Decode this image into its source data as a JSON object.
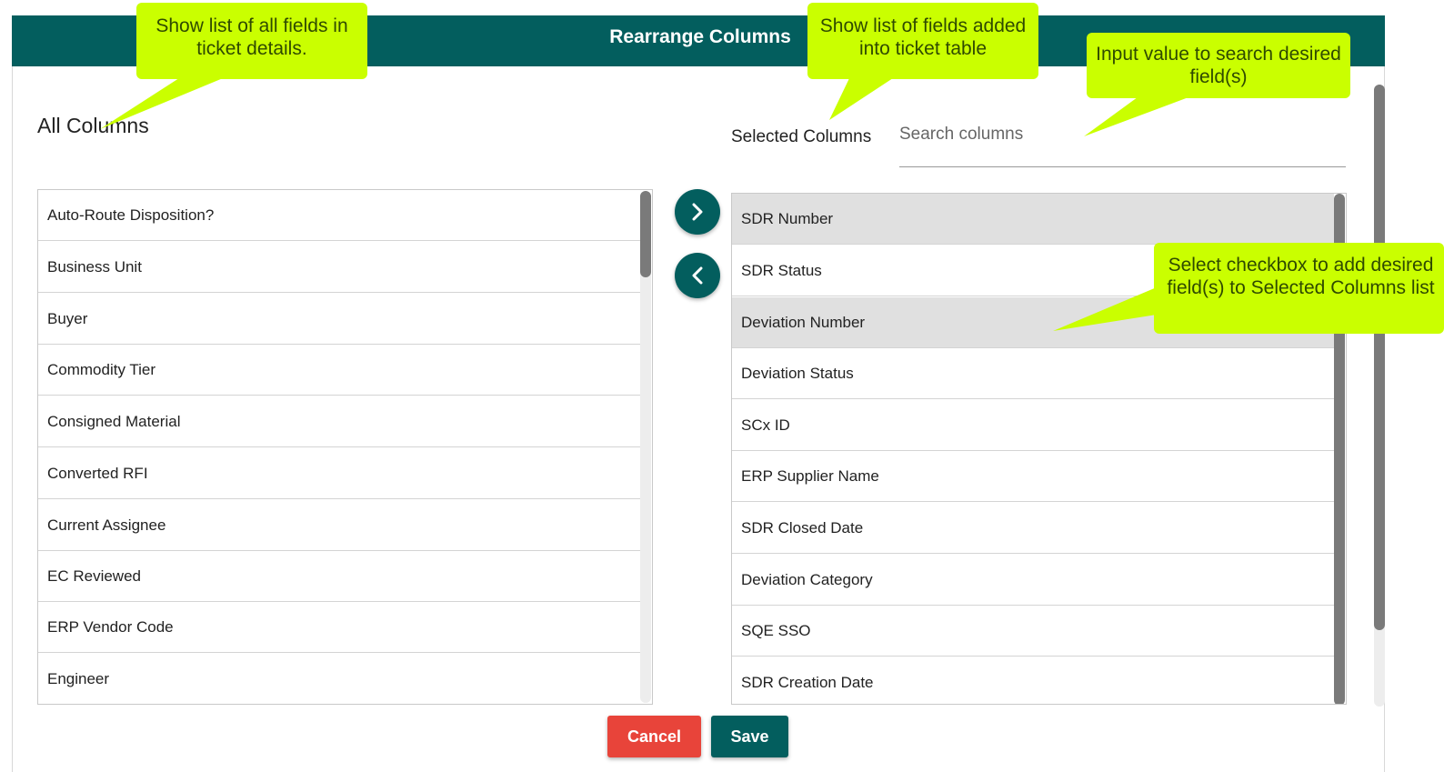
{
  "dialog": {
    "title": "Rearrange Columns"
  },
  "all_columns": {
    "title": "All Columns",
    "items": [
      "Auto-Route Disposition?",
      "Business Unit",
      "Buyer",
      "Commodity Tier",
      "Consigned Material",
      "Converted RFI",
      "Current Assignee",
      "EC Reviewed",
      "ERP Vendor Code",
      "Engineer"
    ]
  },
  "selected_columns": {
    "title": "Selected Columns",
    "items": [
      "SDR Number",
      "SDR Status",
      "Deviation Number",
      "Deviation Status",
      "SCx ID",
      "ERP Supplier Name",
      "SDR Closed Date",
      "Deviation Category",
      "SQE SSO",
      "SDR Creation Date"
    ]
  },
  "search": {
    "placeholder": "Search columns"
  },
  "actions": {
    "cancel_label": "Cancel",
    "save_label": "Save"
  },
  "callouts": {
    "all_fields": "Show list of all fields in ticket details.",
    "added_fields": "Show list of fields added into ticket table",
    "search_hint": "Input value to search desired field(s)",
    "checkbox_hint": "Select checkbox to add desired field(s) to Selected Columns list"
  },
  "colors": {
    "header": "#035e5e",
    "cancel": "#e8443a",
    "save": "#035e5e",
    "callout": "#caff00",
    "row_highlight": "#e0e0e0"
  },
  "icons": {
    "move_right": "chevron-right-icon",
    "move_left": "chevron-left-icon"
  }
}
